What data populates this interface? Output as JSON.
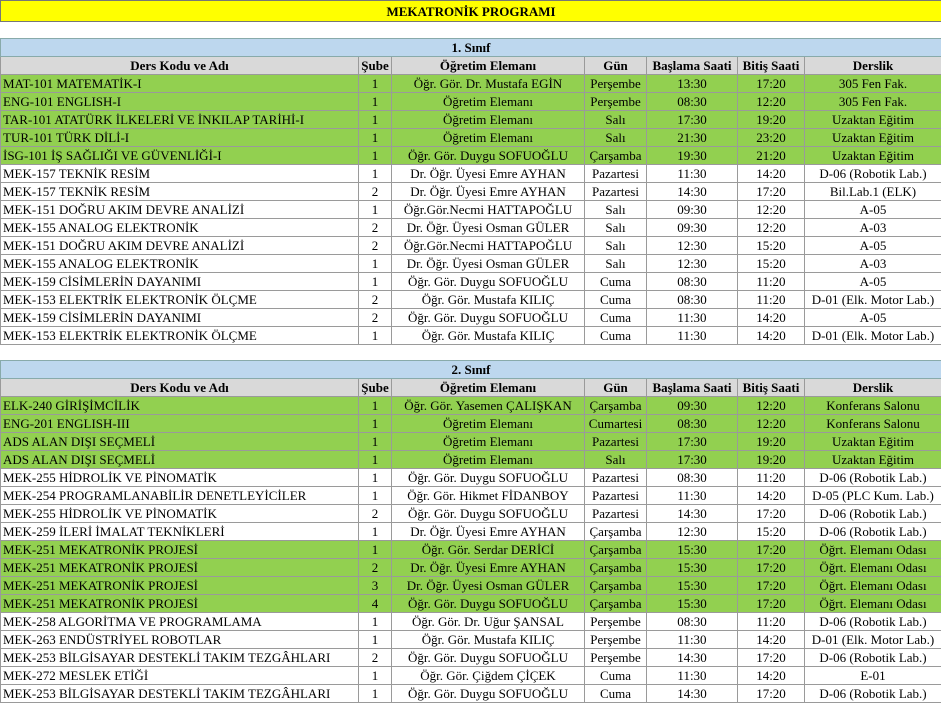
{
  "title": "MEKATRONİK PROGRAMI",
  "headers": [
    "Ders Kodu ve Adı",
    "Şube",
    "Öğretim Elemanı",
    "Gün",
    "Başlama Saati",
    "Bitiş Saati",
    "Derslik"
  ],
  "sections": [
    {
      "label": "1. Sınıf",
      "rows": [
        {
          "course": "MAT-101 MATEMATİK-I",
          "sube": "1",
          "instructor": "Öğr. Gör. Dr. Mustafa EGİN",
          "day": "Perşembe",
          "start": "13:30",
          "end": "17:20",
          "room": "305 Fen Fak.",
          "green": true
        },
        {
          "course": "ENG-101 ENGLISH-I",
          "sube": "1",
          "instructor": "Öğretim Elemanı",
          "day": "Perşembe",
          "start": "08:30",
          "end": "12:20",
          "room": "305 Fen Fak.",
          "green": true
        },
        {
          "course": "TAR-101 ATATÜRK İLKELERİ VE İNKILAP TARİHİ-I",
          "sube": "1",
          "instructor": "Öğretim Elemanı",
          "day": "Salı",
          "start": "17:30",
          "end": "19:20",
          "room": "Uzaktan Eğitim",
          "green": true
        },
        {
          "course": "TUR-101 TÜRK DİLİ-I",
          "sube": "1",
          "instructor": "Öğretim Elemanı",
          "day": "Salı",
          "start": "21:30",
          "end": "23:20",
          "room": "Uzaktan Eğitim",
          "green": true
        },
        {
          "course": "İSG-101 İŞ SAĞLIĞI VE GÜVENLİĞİ-I",
          "sube": "1",
          "instructor": "Öğr. Gör. Duygu SOFUOĞLU",
          "day": "Çarşamba",
          "start": "19:30",
          "end": "21:20",
          "room": "Uzaktan Eğitim",
          "green": true
        },
        {
          "course": "MEK-157 TEKNİK RESİM",
          "sube": "1",
          "instructor": "Dr. Öğr. Üyesi Emre AYHAN",
          "day": "Pazartesi",
          "start": "11:30",
          "end": "14:20",
          "room": "D-06 (Robotik Lab.)",
          "green": false
        },
        {
          "course": "MEK-157 TEKNİK RESİM",
          "sube": "2",
          "instructor": "Dr. Öğr. Üyesi Emre AYHAN",
          "day": "Pazartesi",
          "start": "14:30",
          "end": "17:20",
          "room": "Bil.Lab.1 (ELK)",
          "green": false
        },
        {
          "course": "MEK-151 DOĞRU AKIM DEVRE ANALİZİ",
          "sube": "1",
          "instructor": "Öğr.Gör.Necmi HATTAPOĞLU",
          "day": "Salı",
          "start": "09:30",
          "end": "12:20",
          "room": "A-05",
          "green": false
        },
        {
          "course": "MEK-155 ANALOG ELEKTRONİK",
          "sube": "2",
          "instructor": "Dr. Öğr. Üyesi Osman GÜLER",
          "day": "Salı",
          "start": "09:30",
          "end": "12:20",
          "room": "A-03",
          "green": false
        },
        {
          "course": "MEK-151 DOĞRU AKIM DEVRE ANALİZİ",
          "sube": "2",
          "instructor": "Öğr.Gör.Necmi HATTAPOĞLU",
          "day": "Salı",
          "start": "12:30",
          "end": "15:20",
          "room": "A-05",
          "green": false
        },
        {
          "course": "MEK-155 ANALOG ELEKTRONİK",
          "sube": "1",
          "instructor": "Dr. Öğr. Üyesi Osman GÜLER",
          "day": "Salı",
          "start": "12:30",
          "end": "15:20",
          "room": "A-03",
          "green": false
        },
        {
          "course": "MEK-159 CİSİMLERİN DAYANIMI",
          "sube": "1",
          "instructor": "Öğr. Gör. Duygu SOFUOĞLU",
          "day": "Cuma",
          "start": "08:30",
          "end": "11:20",
          "room": "A-05",
          "green": false
        },
        {
          "course": "MEK-153 ELEKTRİK ELEKTRONİK ÖLÇME",
          "sube": "2",
          "instructor": "Öğr. Gör. Mustafa KILIÇ",
          "day": "Cuma",
          "start": "08:30",
          "end": "11:20",
          "room": "D-01 (Elk. Motor Lab.)",
          "green": false
        },
        {
          "course": "MEK-159 CİSİMLERİN DAYANIMI",
          "sube": "2",
          "instructor": "Öğr. Gör. Duygu SOFUOĞLU",
          "day": "Cuma",
          "start": "11:30",
          "end": "14:20",
          "room": "A-05",
          "green": false
        },
        {
          "course": "MEK-153 ELEKTRİK ELEKTRONİK ÖLÇME",
          "sube": "1",
          "instructor": "Öğr. Gör. Mustafa KILIÇ",
          "day": "Cuma",
          "start": "11:30",
          "end": "14:20",
          "room": "D-01 (Elk. Motor Lab.)",
          "green": false
        }
      ]
    },
    {
      "label": "2. Sınıf",
      "rows": [
        {
          "course": "ELK-240 GİRİŞİMCİLİK",
          "sube": "1",
          "instructor": "Öğr. Gör. Yasemen ÇALIŞKAN",
          "day": "Çarşamba",
          "start": "09:30",
          "end": "12:20",
          "room": "Konferans Salonu",
          "green": true
        },
        {
          "course": "ENG-201 ENGLISH-III",
          "sube": "1",
          "instructor": "Öğretim Elemanı",
          "day": "Cumartesi",
          "start": "08:30",
          "end": "12:20",
          "room": "Konferans Salonu",
          "green": true
        },
        {
          "course": "ADS ALAN DIŞI SEÇMELİ",
          "sube": "1",
          "instructor": "Öğretim Elemanı",
          "day": "Pazartesi",
          "start": "17:30",
          "end": "19:20",
          "room": "Uzaktan Eğitim",
          "green": true
        },
        {
          "course": "ADS ALAN DIŞI SEÇMELİ",
          "sube": "1",
          "instructor": "Öğretim Elemanı",
          "day": "Salı",
          "start": "17:30",
          "end": "19:20",
          "room": "Uzaktan Eğitim",
          "green": true
        },
        {
          "course": "MEK-255 HİDROLİK VE PİNOMATİK",
          "sube": "1",
          "instructor": "Öğr. Gör. Duygu SOFUOĞLU",
          "day": "Pazartesi",
          "start": "08:30",
          "end": "11:20",
          "room": "D-06 (Robotik Lab.)",
          "green": false
        },
        {
          "course": "MEK-254 PROGRAMLANABİLİR DENETLEYİCİLER",
          "sube": "1",
          "instructor": "Öğr. Gör. Hikmet FİDANBOY",
          "day": "Pazartesi",
          "start": "11:30",
          "end": "14:20",
          "room": "D-05 (PLC Kum. Lab.)",
          "green": false
        },
        {
          "course": "MEK-255 HİDROLİK VE PİNOMATİK",
          "sube": "2",
          "instructor": "Öğr. Gör. Duygu SOFUOĞLU",
          "day": "Pazartesi",
          "start": "14:30",
          "end": "17:20",
          "room": "D-06 (Robotik Lab.)",
          "green": false
        },
        {
          "course": "MEK-259 İLERİ İMALAT TEKNİKLERİ",
          "sube": "1",
          "instructor": "Dr. Öğr. Üyesi Emre AYHAN",
          "day": "Çarşamba",
          "start": "12:30",
          "end": "15:20",
          "room": "D-06 (Robotik Lab.)",
          "green": false
        },
        {
          "course": "MEK-251 MEKATRONİK PROJESİ",
          "sube": "1",
          "instructor": "Öğr. Gör. Serdar DERİCİ",
          "day": "Çarşamba",
          "start": "15:30",
          "end": "17:20",
          "room": "Öğrt. Elemanı Odası",
          "green": true
        },
        {
          "course": "MEK-251 MEKATRONİK PROJESİ",
          "sube": "2",
          "instructor": "Dr. Öğr. Üyesi Emre AYHAN",
          "day": "Çarşamba",
          "start": "15:30",
          "end": "17:20",
          "room": "Öğrt. Elemanı Odası",
          "green": true
        },
        {
          "course": "MEK-251 MEKATRONİK PROJESİ",
          "sube": "3",
          "instructor": "Dr. Öğr. Üyesi Osman GÜLER",
          "day": "Çarşamba",
          "start": "15:30",
          "end": "17:20",
          "room": "Öğrt. Elemanı Odası",
          "green": true
        },
        {
          "course": "MEK-251 MEKATRONİK PROJESİ",
          "sube": "4",
          "instructor": "Öğr. Gör. Duygu SOFUOĞLU",
          "day": "Çarşamba",
          "start": "15:30",
          "end": "17:20",
          "room": "Öğrt. Elemanı Odası",
          "green": true
        },
        {
          "course": "MEK-258 ALGORİTMA VE PROGRAMLAMA",
          "sube": "1",
          "instructor": "Öğr. Gör. Dr. Uğur ŞANSAL",
          "day": "Perşembe",
          "start": "08:30",
          "end": "11:20",
          "room": "D-06 (Robotik Lab.)",
          "green": false
        },
        {
          "course": "MEK-263 ENDÜSTRİYEL ROBOTLAR",
          "sube": "1",
          "instructor": "Öğr. Gör. Mustafa KILIÇ",
          "day": "Perşembe",
          "start": "11:30",
          "end": "14:20",
          "room": "D-01 (Elk. Motor Lab.)",
          "green": false
        },
        {
          "course": "MEK-253 BİLGİSAYAR DESTEKLİ TAKIM TEZGÂHLARI",
          "sube": "2",
          "instructor": "Öğr. Gör. Duygu SOFUOĞLU",
          "day": "Perşembe",
          "start": "14:30",
          "end": "17:20",
          "room": "D-06 (Robotik Lab.)",
          "green": false
        },
        {
          "course": "MEK-272 MESLEK ETİĞİ",
          "sube": "1",
          "instructor": "Öğr. Gör. Çiğdem ÇİÇEK",
          "day": "Cuma",
          "start": "11:30",
          "end": "14:20",
          "room": "E-01",
          "green": false
        },
        {
          "course": "MEK-253 BİLGİSAYAR DESTEKLİ TAKIM TEZGÂHLARI",
          "sube": "1",
          "instructor": "Öğr. Gör. Duygu SOFUOĞLU",
          "day": "Cuma",
          "start": "14:30",
          "end": "17:20",
          "room": "D-06 (Robotik Lab.)",
          "green": false
        }
      ]
    }
  ],
  "colors": {
    "highlight": "#92d050",
    "title_bg": "#ffff00",
    "class_bg": "#bdd7ee",
    "header_bg": "#d9d9d9"
  }
}
